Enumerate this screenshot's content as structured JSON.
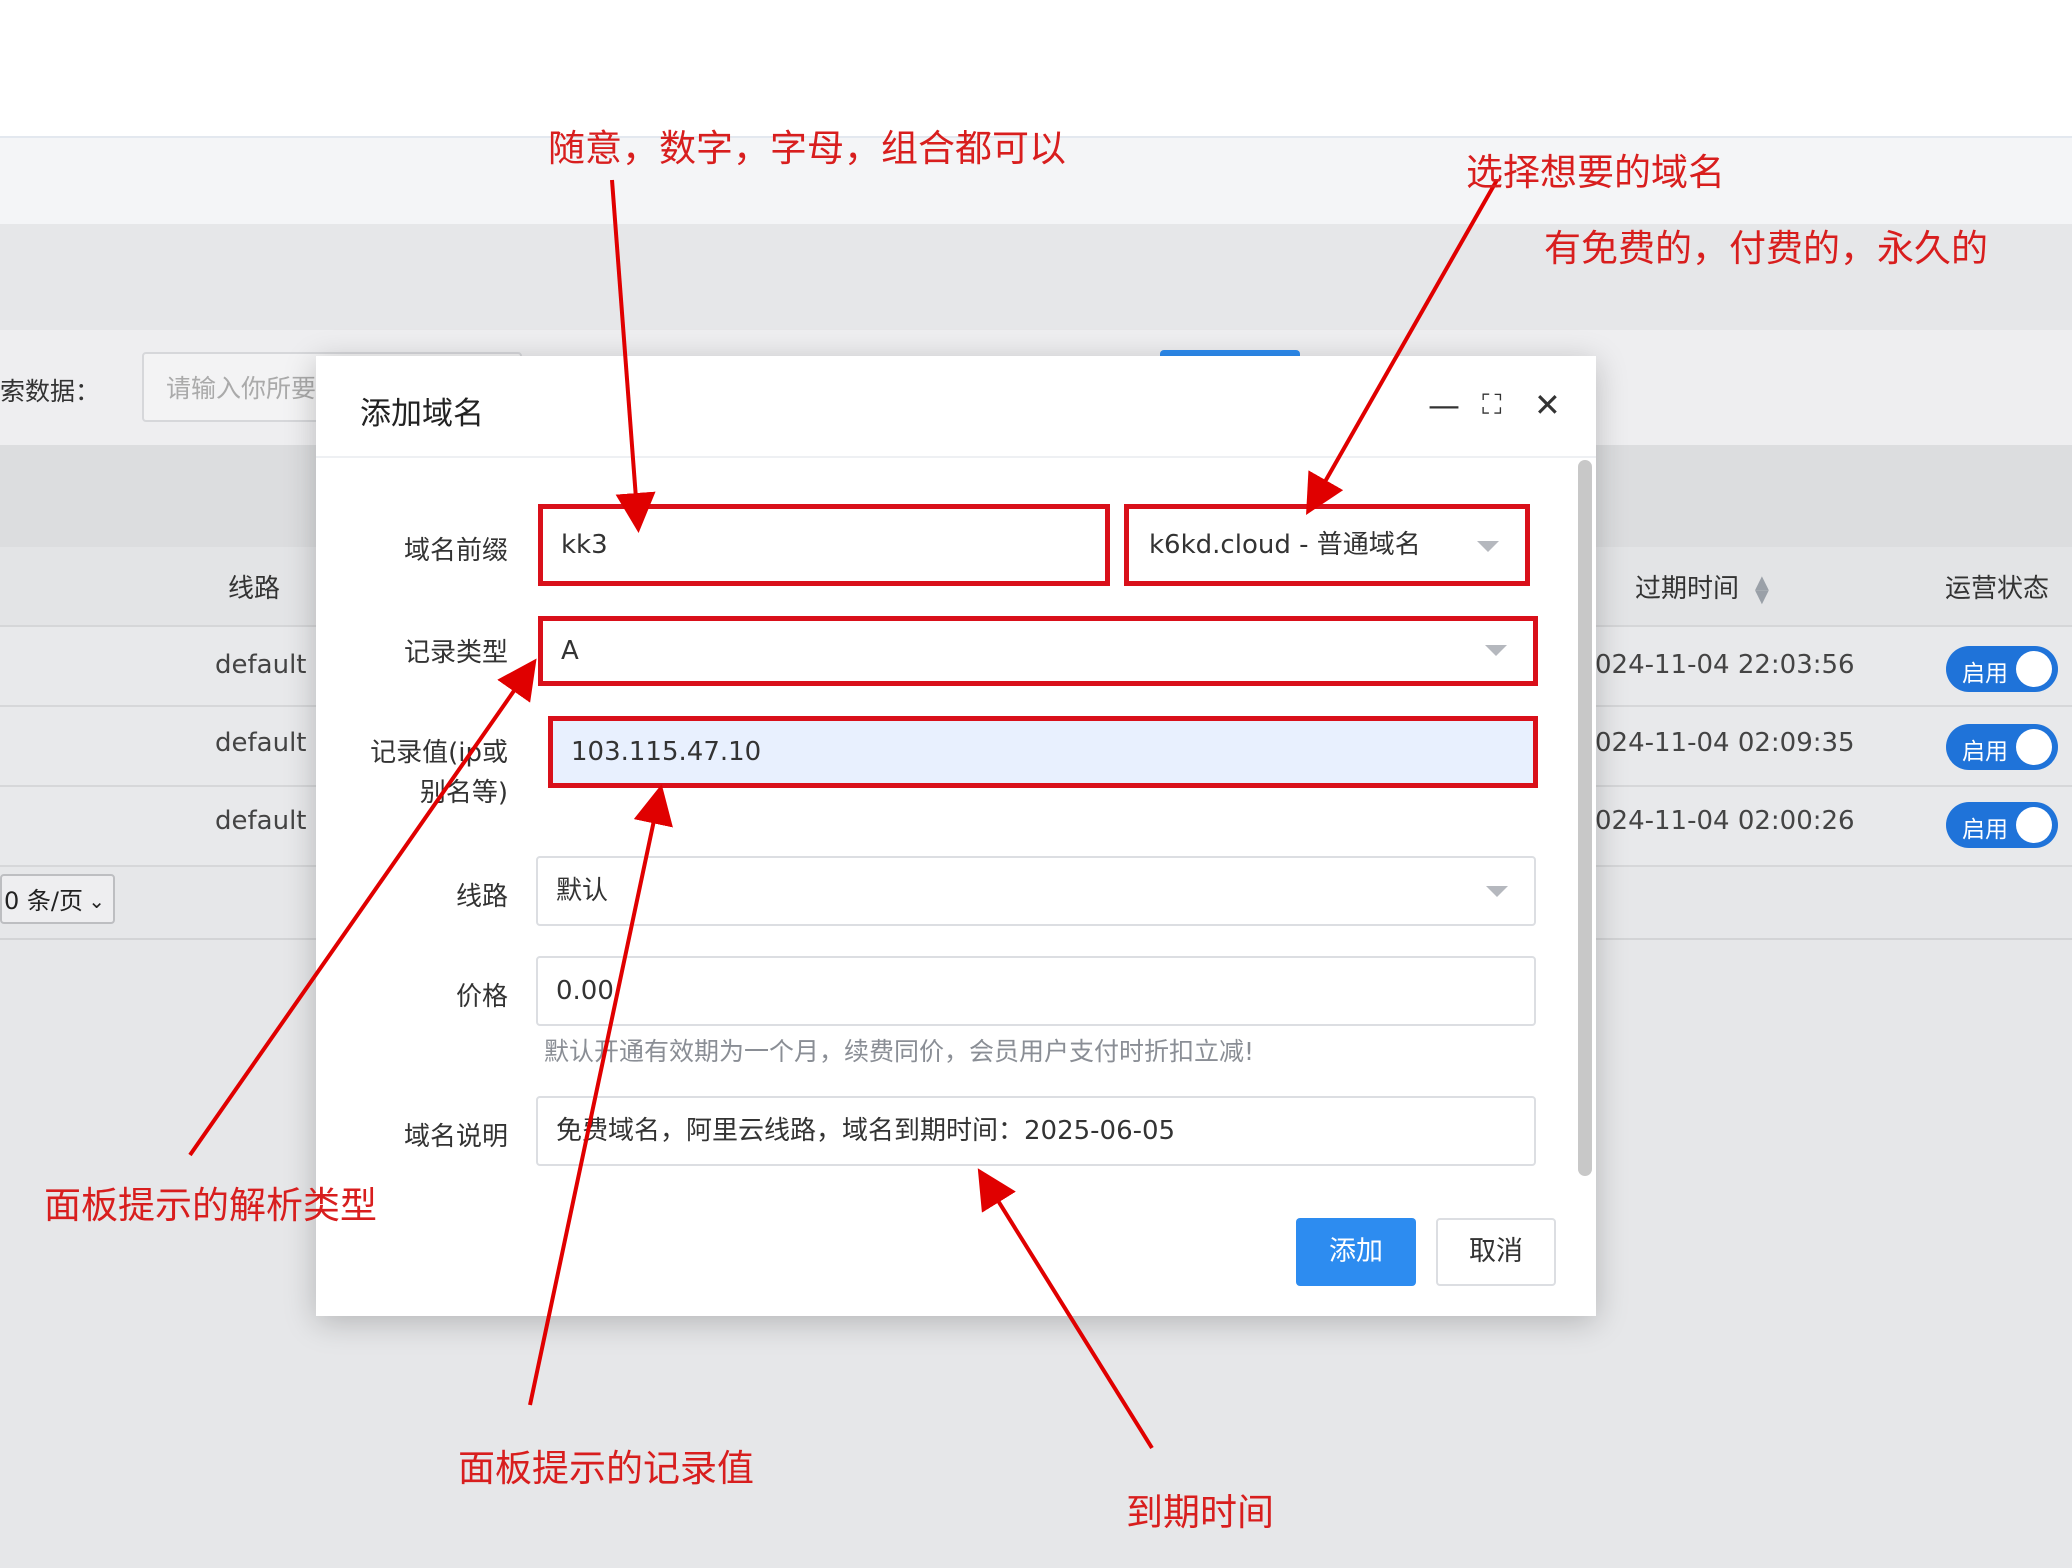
{
  "background": {
    "search_label": "索数据：",
    "search_placeholder": "请输入你所要",
    "table_headers": {
      "route": "线路",
      "expire": "过期时间",
      "status": "运营状态"
    },
    "rows": [
      {
        "route": "default",
        "expire": "024-11-04 22:03:56",
        "status": "启用"
      },
      {
        "route": "default",
        "expire": "024-11-04 02:09:35",
        "status": "启用"
      },
      {
        "route": "default",
        "expire": "024-11-04 02:00:26",
        "status": "启用"
      }
    ],
    "page_size": "0 条/页"
  },
  "dialog": {
    "title": "添加域名",
    "controls": {
      "minimize": "—",
      "maximize": "⛶",
      "close": "✕"
    },
    "fields": {
      "prefix_label": "域名前缀",
      "prefix_value": "kk3",
      "domain_select": "k6kd.cloud - 普通域名",
      "record_type_label": "记录类型",
      "record_type_value": "A",
      "record_value_label_1": "记录值(ip或",
      "record_value_label_2": "别名等)",
      "record_value": "103.115.47.10",
      "route_label": "线路",
      "route_value": "默认",
      "price_label": "价格",
      "price_value": "0.00",
      "price_hint": "默认开通有效期为一个月，续费同价，会员用户支付时折扣立减!",
      "desc_label": "域名说明",
      "desc_value": "免费域名，阿里云线路，域名到期时间：2025-06-05"
    },
    "buttons": {
      "add": "添加",
      "cancel": "取消"
    }
  },
  "annotations": {
    "prefix_note": "随意，数字，字母，组合都可以",
    "domain_note": "选择想要的域名",
    "domain_note_2": "有免费的，付费的，永久的",
    "type_note": "面板提示的解析类型",
    "value_note": "面板提示的记录值",
    "expire_note": "到期时间"
  },
  "colors": {
    "annotation": "#d81e1e",
    "primary_button": "#2d8cf0",
    "toggle": "#1f73d9"
  }
}
